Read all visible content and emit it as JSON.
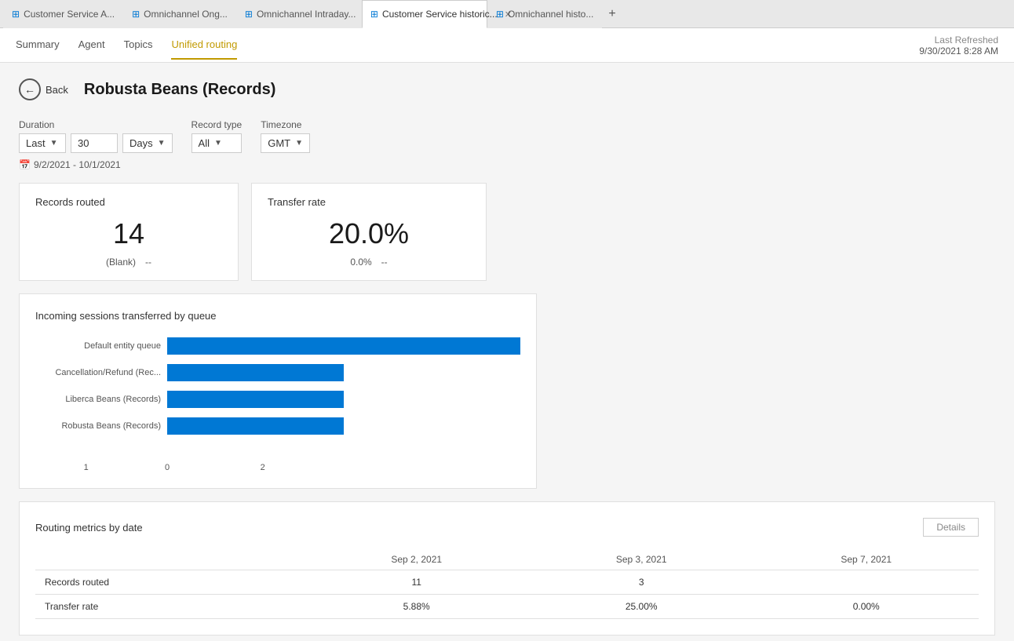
{
  "tabs": [
    {
      "id": "tab1",
      "icon": "⊞",
      "label": "Customer Service A...",
      "active": false,
      "closable": false
    },
    {
      "id": "tab2",
      "icon": "⊞",
      "label": "Omnichannel Ong...",
      "active": false,
      "closable": false
    },
    {
      "id": "tab3",
      "icon": "⊞",
      "label": "Omnichannel Intraday...",
      "active": false,
      "closable": false
    },
    {
      "id": "tab4",
      "icon": "⊞",
      "label": "Customer Service historic...",
      "active": true,
      "closable": true
    },
    {
      "id": "tab5",
      "icon": "⊞",
      "label": "Omnichannel histo...",
      "active": false,
      "closable": false
    }
  ],
  "nav": {
    "links": [
      "Summary",
      "Agent",
      "Topics",
      "Unified routing"
    ],
    "active_link": "Unified routing"
  },
  "last_refreshed": {
    "label": "Last Refreshed",
    "value": "9/30/2021 8:28 AM"
  },
  "page": {
    "back_label": "Back",
    "title": "Robusta Beans (Records)"
  },
  "filters": {
    "duration_label": "Duration",
    "duration_prefix": "Last",
    "duration_value": "30",
    "duration_unit": "Days",
    "record_type_label": "Record type",
    "record_type_value": "All",
    "timezone_label": "Timezone",
    "timezone_value": "GMT",
    "date_range": "9/2/2021 - 10/1/2021"
  },
  "cards": [
    {
      "title": "Records routed",
      "value": "14",
      "sub_items": [
        "(Blank)",
        "--"
      ]
    },
    {
      "title": "Transfer rate",
      "value": "20.0%",
      "sub_items": [
        "0.0%",
        "--"
      ]
    }
  ],
  "bar_chart": {
    "title": "Incoming sessions transferred by queue",
    "bars": [
      {
        "label": "Default entity queue",
        "value": 2,
        "max": 2
      },
      {
        "label": "Cancellation/Refund (Rec...",
        "value": 1,
        "max": 2
      },
      {
        "label": "Liberca Beans (Records)",
        "value": 1,
        "max": 2
      },
      {
        "label": "Robusta Beans (Records)",
        "value": 1,
        "max": 2
      }
    ],
    "axis_labels": [
      "0",
      "1",
      "2"
    ]
  },
  "metrics_table": {
    "title": "Routing metrics by date",
    "details_btn": "Details",
    "columns": [
      "",
      "Sep 2, 2021",
      "Sep 3, 2021",
      "Sep 7, 2021"
    ],
    "rows": [
      {
        "metric": "Records routed",
        "values": [
          "11",
          "3",
          ""
        ]
      },
      {
        "metric": "Transfer rate",
        "values": [
          "5.88%",
          "25.00%",
          "0.00%"
        ]
      }
    ]
  }
}
